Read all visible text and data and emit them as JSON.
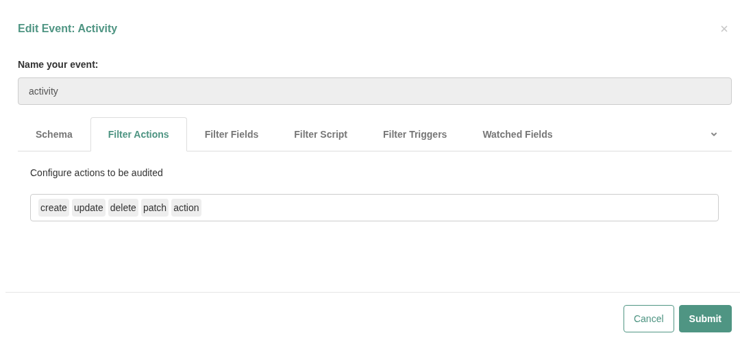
{
  "dialog": {
    "title": "Edit Event: Activity"
  },
  "name_field": {
    "label": "Name your event:",
    "value": "activity",
    "disabled": true
  },
  "tabs": [
    {
      "label": "Schema",
      "selected": false
    },
    {
      "label": "Filter Actions",
      "selected": true
    },
    {
      "label": "Filter Fields",
      "selected": false
    },
    {
      "label": "Filter Script",
      "selected": false
    },
    {
      "label": "Filter Triggers",
      "selected": false
    },
    {
      "label": "Watched Fields",
      "selected": false
    }
  ],
  "panel": {
    "description": "Configure actions to be audited",
    "tags": [
      "create",
      "update",
      "delete",
      "patch",
      "action"
    ]
  },
  "buttons": [
    {
      "label": "Cancel",
      "kind": "secondary"
    },
    {
      "label": "Submit",
      "kind": "primary"
    }
  ]
}
